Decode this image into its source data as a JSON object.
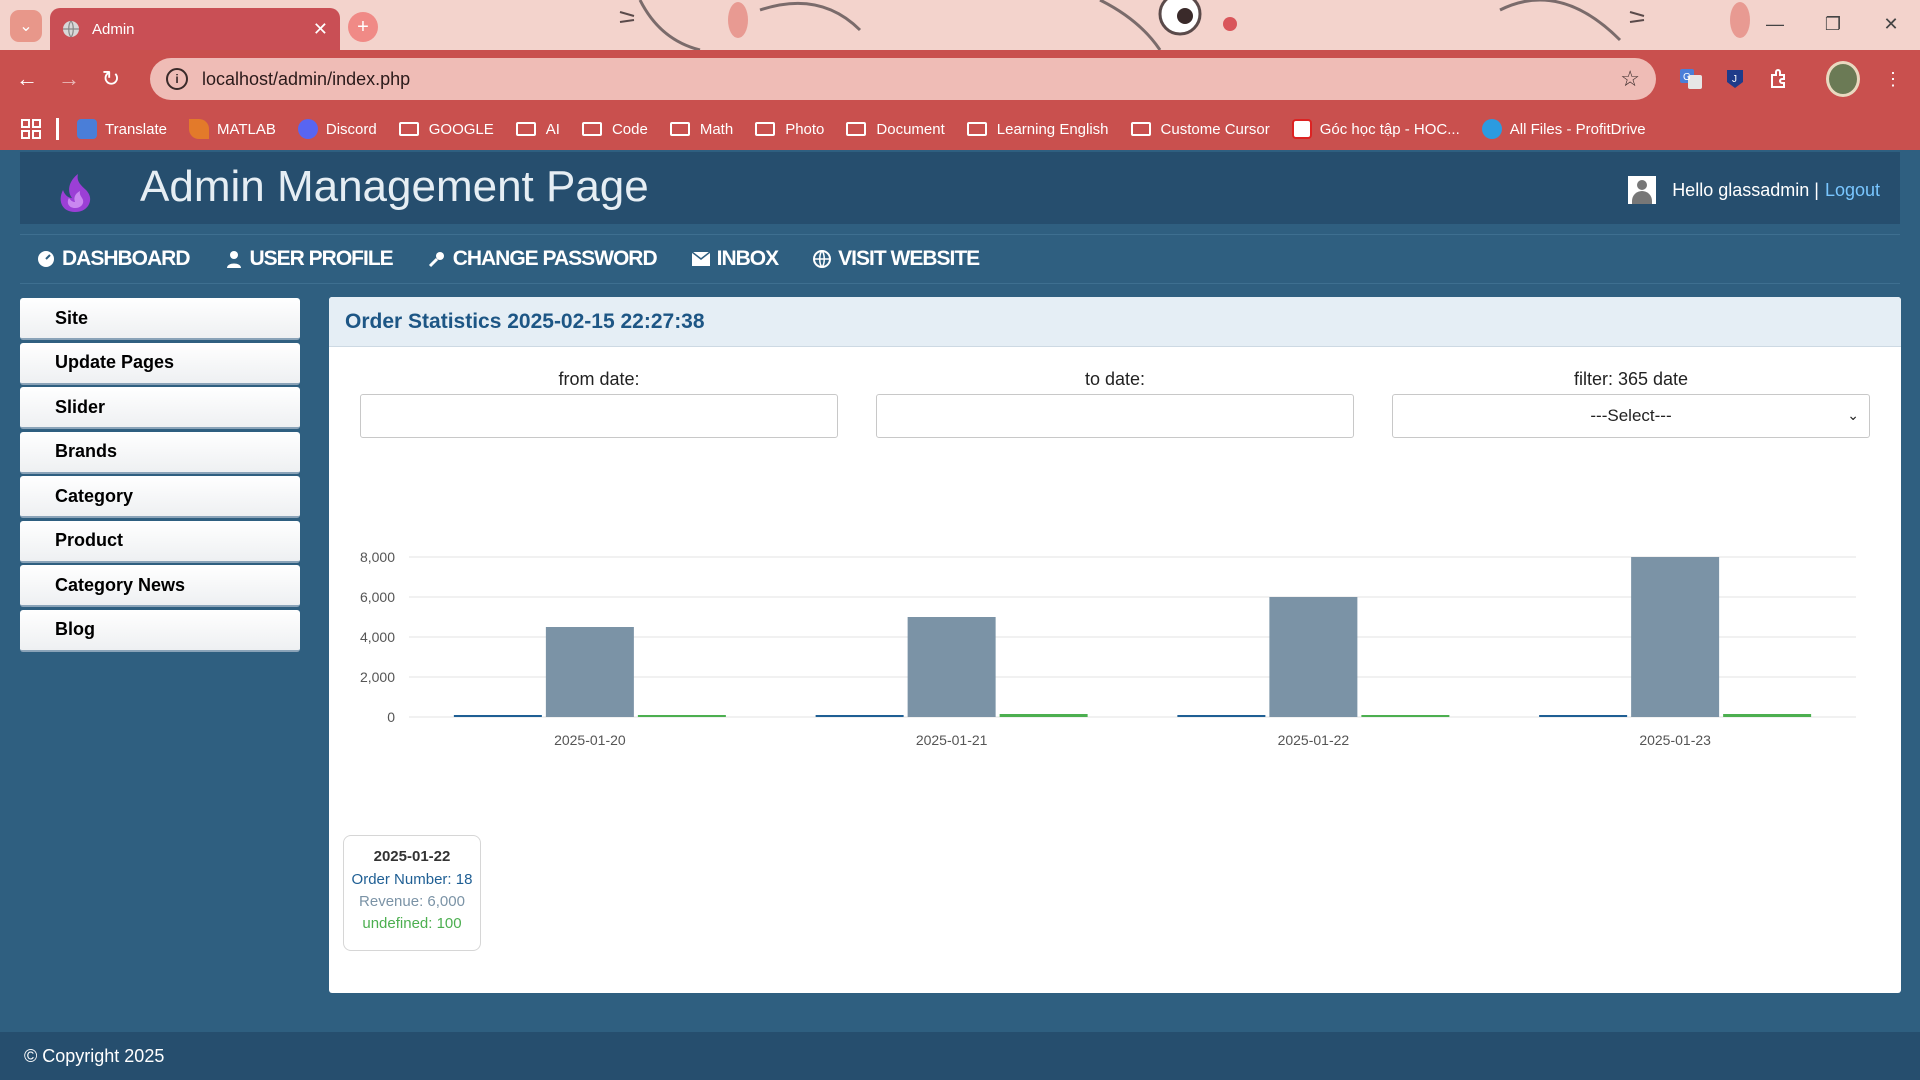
{
  "browser": {
    "tab_title": "Admin",
    "url": "localhost/admin/index.php",
    "bookmarks": [
      "Translate",
      "MATLAB",
      "Discord",
      "GOOGLE",
      "AI",
      "Code",
      "Math",
      "Photo",
      "Document",
      "Learning English",
      "Custome Cursor",
      "Góc học tập - HOC...",
      "All Files - ProfitDrive"
    ]
  },
  "header": {
    "title": "Admin Management Page",
    "greeting": "Hello glassadmin |",
    "logout": "Logout"
  },
  "topnav": [
    "DASHBOARD",
    "USER PROFILE",
    "CHANGE PASSWORD",
    "INBOX",
    "VISIT WEBSITE"
  ],
  "sidebar": [
    "Site",
    "Update Pages",
    "Slider",
    "Brands",
    "Category",
    "Product",
    "Category News",
    "Blog"
  ],
  "panel": {
    "title": "Order Statistics 2025-02-15 22:27:38",
    "from_label": "from date:",
    "to_label": "to date:",
    "filter_label": "filter: 365 date",
    "filter_value": "---Select---"
  },
  "chart_data": {
    "type": "bar",
    "categories": [
      "2025-01-20",
      "2025-01-21",
      "2025-01-22",
      "2025-01-23"
    ],
    "series": [
      {
        "name": "Order Number",
        "values": [
          15,
          16,
          18,
          20
        ],
        "color": "#1f5f94"
      },
      {
        "name": "Revenue",
        "values": [
          4500,
          5000,
          6000,
          8000
        ],
        "color": "#7b93a6"
      },
      {
        "name": "undefined",
        "values": [
          100,
          150,
          100,
          150
        ],
        "color": "#4caf50"
      }
    ],
    "yticks": [
      "0",
      "2,000",
      "4,000",
      "6,000",
      "8,000"
    ],
    "ylim": [
      0,
      8000
    ],
    "grid": true
  },
  "tooltip": {
    "date": "2025-01-22",
    "line1": "Order Number: 18",
    "line2": "Revenue: 6,000",
    "line3": "undefined: 100",
    "colors": [
      "#1f5f94",
      "#7b93a6",
      "#4caf50"
    ]
  },
  "footer": "© Copyright 2025"
}
